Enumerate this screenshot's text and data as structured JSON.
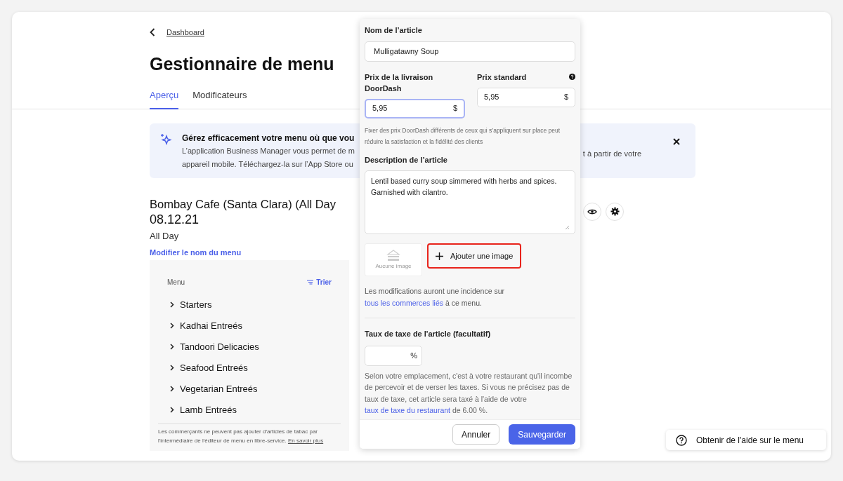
{
  "back": {
    "label": "Dashboard"
  },
  "title": "Gestionnaire de menu",
  "tabs": [
    {
      "label": "Aperçu",
      "selected": true
    },
    {
      "label": "Modificateurs",
      "selected": false
    }
  ],
  "banner": {
    "title": "Gérez efficacement votre menu où que vou",
    "lines": [
      "L’application Business Manager vous permet de m",
      "appareil mobile. Téléchargez-la sur l’App Store ou"
    ],
    "line_end": "t à partir de votre"
  },
  "menu": {
    "name_lines": [
      "Bombay Cafe (Santa Clara) (All Day",
      "08.12.21"
    ],
    "availability": "All Day",
    "rename_link": "Modifier le nom du menu"
  },
  "list": {
    "header": "Menu",
    "sort": "Trier",
    "items": [
      "Starters",
      "Kadhai Entreés",
      "Tandoori Delicacies",
      "Seafood Entreés",
      "Vegetarian Entreés",
      "Lamb Entreés"
    ],
    "footer_text": "Les commerçants ne peuvent pas ajouter d'articles de tabac par l'intermédiaire de l'éditeur de menu en libre-service.",
    "footer_link": "En savoir plus"
  },
  "modal": {
    "name_label": "Nom de l’article",
    "name_value": "Mulligatawny Soup",
    "delivery_label": "Prix de la livraison DoorDash",
    "delivery_value": "5,95",
    "delivery_currency": "$",
    "delivery_focused": true,
    "standard_label": "Prix standard",
    "standard_value": "5,95",
    "standard_currency": "$",
    "price_hint": "Fixer des prix DoorDash différents de ceux qui s’appliquent sur place peut réduire la satisfaction et la fidélité des clients",
    "description_label": "Description de l’article",
    "description_value": "Lentil based curry soup simmered with herbs and spices. Garnished with cilantro.",
    "image_placeholder": "Aucune image",
    "add_image": "Ajouter une image",
    "add_image_highlighted": true,
    "notice": {
      "before": "Les modifications auront une incidence sur",
      "link": "tous les commerces liés",
      "after": "à ce menu."
    },
    "tax_label": "Taux de taxe de l'article (facultatif)",
    "tax_unit": "%",
    "tax_note": {
      "before": "Selon votre emplacement, c'est à votre restaurant qu'il incombe de percevoir et de verser les taxes. Si vous ne précisez pas de taux de taxe, cet article sera taxé à l'aide de votre",
      "link": "taux de taxe du restaurant",
      "after": "de 6.00 %."
    },
    "cancel": "Annuler",
    "save": "Sauvegarder"
  },
  "help_button": {
    "label": "Obtenir de l'aide sur le menu"
  }
}
